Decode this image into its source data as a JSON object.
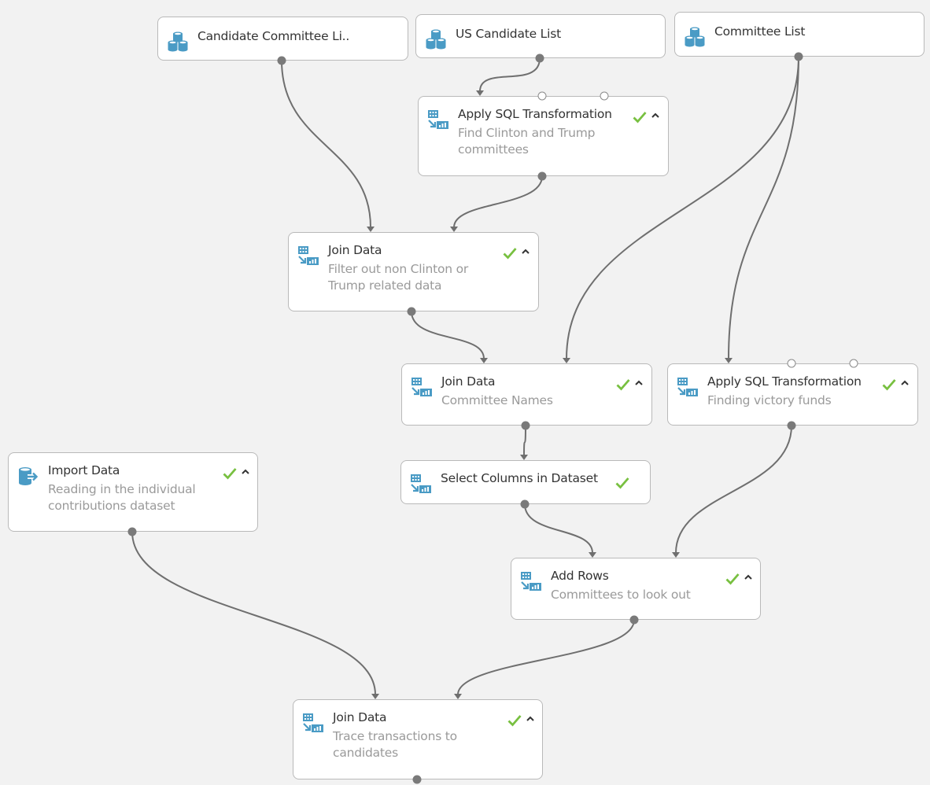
{
  "canvas": {
    "background": "#f2f2f2"
  },
  "colors": {
    "icon_blue": "#4a9bc5",
    "check_green": "#78c040",
    "edge_gray": "#6f6f6f"
  },
  "nodes": [
    {
      "id": "candidate-committee-list",
      "type": "dataset",
      "icon": "dataset-icon",
      "title": "Candidate Committee Li..",
      "desc": "",
      "status": ""
    },
    {
      "id": "us-candidate-list",
      "type": "dataset",
      "icon": "dataset-icon",
      "title": "US Candidate List",
      "desc": "",
      "status": ""
    },
    {
      "id": "committee-list",
      "type": "dataset",
      "icon": "dataset-icon",
      "title": "Committee List",
      "desc": "",
      "status": ""
    },
    {
      "id": "apply-sql-1",
      "type": "module",
      "icon": "transform-module-icon",
      "title": "Apply SQL Transformation",
      "desc": "Find Clinton and Trump committees",
      "status": "completed"
    },
    {
      "id": "join-data-1",
      "type": "module",
      "icon": "transform-module-icon",
      "title": "Join Data",
      "desc": "Filter out non Clinton or Trump related data",
      "status": "completed"
    },
    {
      "id": "join-data-2",
      "type": "module",
      "icon": "transform-module-icon",
      "title": "Join Data",
      "desc": "Committee Names",
      "status": "completed"
    },
    {
      "id": "apply-sql-2",
      "type": "module",
      "icon": "transform-module-icon",
      "title": "Apply SQL Transformation",
      "desc": "Finding victory funds",
      "status": "completed"
    },
    {
      "id": "select-columns",
      "type": "module",
      "icon": "transform-module-icon",
      "title": "Select Columns in Dataset",
      "desc": "",
      "status": "completed"
    },
    {
      "id": "import-data",
      "type": "import",
      "icon": "import-data-icon",
      "title": "Import Data",
      "desc": "Reading in the individual contributions dataset",
      "status": "completed"
    },
    {
      "id": "add-rows",
      "type": "module",
      "icon": "transform-module-icon",
      "title": "Add Rows",
      "desc": "Committees to look out",
      "status": "completed"
    },
    {
      "id": "join-data-3",
      "type": "module",
      "icon": "transform-module-icon",
      "title": "Join Data",
      "desc": "Trace transactions to candidates",
      "status": "completed"
    }
  ],
  "edges": [
    {
      "from": "us-candidate-list",
      "to": "apply-sql-1",
      "to_port": 1
    },
    {
      "from": "candidate-committee-list",
      "to": "join-data-1",
      "to_port": 1
    },
    {
      "from": "apply-sql-1",
      "to": "join-data-1",
      "to_port": 2
    },
    {
      "from": "join-data-1",
      "to": "join-data-2",
      "to_port": 1
    },
    {
      "from": "committee-list",
      "to": "join-data-2",
      "to_port": 2
    },
    {
      "from": "committee-list",
      "to": "apply-sql-2",
      "to_port": 1
    },
    {
      "from": "join-data-2",
      "to": "select-columns",
      "to_port": 1
    },
    {
      "from": "select-columns",
      "to": "add-rows",
      "to_port": 1
    },
    {
      "from": "apply-sql-2",
      "to": "add-rows",
      "to_port": 2
    },
    {
      "from": "import-data",
      "to": "join-data-3",
      "to_port": 1
    },
    {
      "from": "add-rows",
      "to": "join-data-3",
      "to_port": 2
    }
  ]
}
